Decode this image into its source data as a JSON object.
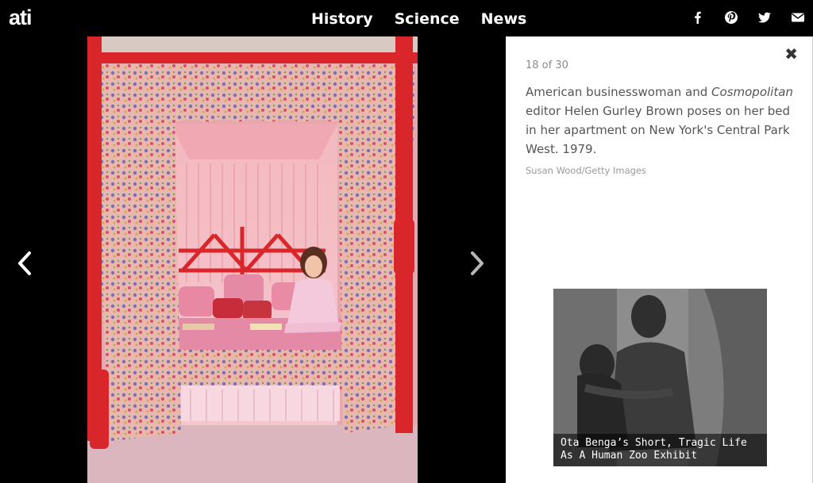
{
  "brand": {
    "logo_text": "ati"
  },
  "nav": {
    "items": [
      "History",
      "Science",
      "News"
    ]
  },
  "social": {
    "icons": [
      "facebook-icon",
      "pinterest-icon",
      "twitter-icon",
      "email-icon"
    ]
  },
  "gallery": {
    "counter": "18 of 30",
    "caption_before": "American businesswoman and ",
    "caption_italic": "Cosmopolitan",
    "caption_after": " editor Helen Gurley Brown poses on her bed in her apartment on New York's Central Park West. 1979.",
    "credit": "Susan Wood/Getty Images",
    "close_symbol": "✖"
  },
  "related": {
    "title": "Ota Benga’s Short, Tragic Life As A Human Zoo Exhibit"
  },
  "colors": {
    "background": "#000000",
    "panel": "#ffffff",
    "accent_red": "#d8262a"
  }
}
